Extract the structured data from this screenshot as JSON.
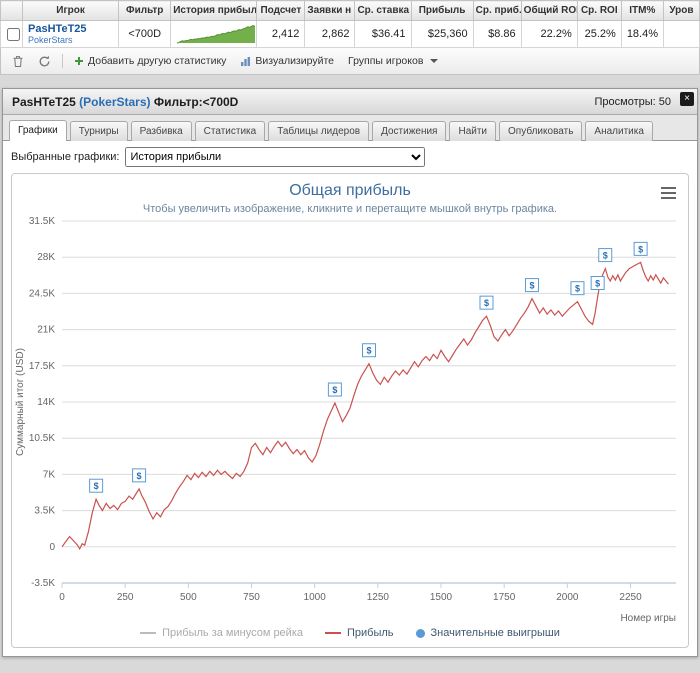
{
  "colors": {
    "accent_blue": "#2a6db5",
    "player_link": "#15569c",
    "sparkline_fill": "#74B04A",
    "sparkline_stroke": "#55913A",
    "chart_title": "#3E6E9E",
    "chart_subtitle": "#6D869F",
    "grid": "#DCDCDC",
    "axis_line": "#C0D0E0",
    "axis_text": "#666666",
    "profit_line": "#C9524F",
    "marker_blue": "#5B9BD5",
    "marker_text": "#2a6db5",
    "legend_text": "#3E576F",
    "legend_disabled": "#AAAAAA"
  },
  "table": {
    "columns": [
      "",
      "Игрок",
      "Фильтр",
      "История прибыли",
      "Подсчет",
      "Заявки н у",
      "Ср. ставка",
      "Прибыль",
      "Ср. приб.",
      "Общий ROI",
      "Ср. ROI",
      "ITM%",
      "Уров"
    ],
    "row": {
      "player": "PasHTeT25",
      "network": "PokerStars",
      "filter": "<700D",
      "count": "2,412",
      "entries": "2,862",
      "avg_stake": "$36.41",
      "profit": "$25,360",
      "avg_profit": "$8.86",
      "total_roi": "22.2%",
      "avg_roi": "25.2%",
      "itm": "18.4%",
      "level": "",
      "sparkline": [
        0,
        0.02,
        0.08,
        0.12,
        0.1,
        0.14,
        0.13,
        0.17,
        0.2,
        0.18,
        0.22,
        0.21,
        0.25,
        0.24,
        0.28,
        0.27,
        0.3,
        0.33,
        0.31,
        0.35,
        0.38,
        0.36,
        0.42,
        0.47,
        0.45,
        0.5,
        0.53,
        0.51,
        0.56,
        0.6,
        0.58,
        0.63,
        0.67,
        0.65,
        0.7,
        0.74,
        0.72,
        0.77,
        0.8,
        0.85,
        0.9,
        0.87,
        0.93,
        0.97,
        0.92
      ]
    }
  },
  "toolbar": {
    "add_stat": "Добавить другую статистику",
    "visualize": "Визуализируйте",
    "groups": "Группы игроков"
  },
  "panel": {
    "title": {
      "name": "PasHTeT25",
      "network": "(PokerStars)",
      "filter": "Фильтр:<700D"
    },
    "views": "Просмотры: 50",
    "close": "×",
    "tabs": [
      {
        "label": "Графики",
        "active": true
      },
      {
        "label": "Турниры",
        "active": false
      },
      {
        "label": "Разбивка",
        "active": false
      },
      {
        "label": "Статистика",
        "active": false
      },
      {
        "label": "Таблицы лидеров",
        "active": false
      },
      {
        "label": "Достижения",
        "active": false
      },
      {
        "label": "Найти",
        "active": false
      },
      {
        "label": "Опубликовать",
        "active": false
      },
      {
        "label": "Аналитика",
        "active": false
      }
    ],
    "selector": {
      "label": "Выбранные графики:",
      "value": "История прибыли"
    }
  },
  "chart_data": {
    "type": "line",
    "title": "Общая прибыль",
    "subtitle": "Чтобы увеличить изображение, кликните и перетащите мышкой внутрь графика.",
    "ylabel": "Суммарный итог (USD)",
    "xlabel": "Номер игры",
    "xlim": [
      0,
      2430
    ],
    "ylim": [
      -3500,
      31500
    ],
    "grid": true,
    "legend_position": "bottom",
    "xticks": [
      [
        0,
        "0"
      ],
      [
        250,
        "250"
      ],
      [
        500,
        "500"
      ],
      [
        750,
        "750"
      ],
      [
        1000,
        "1000"
      ],
      [
        1250,
        "1250"
      ],
      [
        1500,
        "1500"
      ],
      [
        1750,
        "1750"
      ],
      [
        2000,
        "2000"
      ],
      [
        2250,
        "2250"
      ]
    ],
    "yticks": [
      [
        -3500,
        "-3.5K"
      ],
      [
        0,
        "0"
      ],
      [
        3500,
        "3.5K"
      ],
      [
        7000,
        "7K"
      ],
      [
        10500,
        "10.5K"
      ],
      [
        14000,
        "14K"
      ],
      [
        17500,
        "17.5K"
      ],
      [
        21000,
        "21K"
      ],
      [
        24500,
        "24.5K"
      ],
      [
        28000,
        "28K"
      ],
      [
        31500,
        "31.5K"
      ]
    ],
    "legend": [
      {
        "label": "Прибыль за минусом рейка",
        "color": "#BBBBBB",
        "type": "line",
        "disabled": true
      },
      {
        "label": "Прибыль",
        "color": "#C9524F",
        "type": "line",
        "disabled": false
      },
      {
        "label": "Значительные выигрыши",
        "color": "#5B9BD5",
        "type": "dot",
        "disabled": false
      }
    ],
    "series": [
      {
        "name": "Прибыль",
        "color": "#C9524F",
        "points": [
          [
            0,
            0
          ],
          [
            15,
            500
          ],
          [
            30,
            1000
          ],
          [
            45,
            600
          ],
          [
            60,
            200
          ],
          [
            70,
            -200
          ],
          [
            80,
            300
          ],
          [
            90,
            150
          ],
          [
            105,
            1500
          ],
          [
            120,
            3300
          ],
          [
            135,
            4600
          ],
          [
            145,
            4100
          ],
          [
            160,
            3500
          ],
          [
            175,
            4200
          ],
          [
            190,
            3700
          ],
          [
            205,
            4000
          ],
          [
            220,
            3600
          ],
          [
            235,
            4200
          ],
          [
            250,
            4400
          ],
          [
            265,
            4900
          ],
          [
            280,
            4600
          ],
          [
            295,
            5200
          ],
          [
            305,
            5600
          ],
          [
            315,
            5000
          ],
          [
            330,
            4300
          ],
          [
            345,
            3400
          ],
          [
            360,
            2700
          ],
          [
            375,
            3300
          ],
          [
            390,
            2900
          ],
          [
            405,
            3600
          ],
          [
            420,
            3900
          ],
          [
            435,
            4500
          ],
          [
            450,
            5200
          ],
          [
            465,
            5800
          ],
          [
            480,
            6300
          ],
          [
            495,
            6900
          ],
          [
            510,
            6500
          ],
          [
            525,
            7100
          ],
          [
            540,
            6700
          ],
          [
            555,
            7200
          ],
          [
            570,
            6800
          ],
          [
            585,
            7300
          ],
          [
            600,
            6900
          ],
          [
            615,
            7400
          ],
          [
            630,
            7000
          ],
          [
            645,
            7300
          ],
          [
            660,
            6900
          ],
          [
            675,
            6600
          ],
          [
            690,
            7100
          ],
          [
            705,
            6800
          ],
          [
            720,
            7300
          ],
          [
            735,
            8100
          ],
          [
            750,
            9600
          ],
          [
            765,
            10000
          ],
          [
            780,
            9400
          ],
          [
            795,
            8900
          ],
          [
            810,
            9600
          ],
          [
            825,
            9100
          ],
          [
            840,
            9700
          ],
          [
            855,
            10200
          ],
          [
            870,
            9700
          ],
          [
            885,
            10100
          ],
          [
            900,
            9500
          ],
          [
            915,
            9000
          ],
          [
            930,
            9400
          ],
          [
            945,
            8900
          ],
          [
            960,
            9300
          ],
          [
            975,
            8600
          ],
          [
            990,
            8200
          ],
          [
            1005,
            8800
          ],
          [
            1020,
            9900
          ],
          [
            1035,
            11200
          ],
          [
            1050,
            12300
          ],
          [
            1065,
            13100
          ],
          [
            1080,
            13900
          ],
          [
            1095,
            13000
          ],
          [
            1110,
            12100
          ],
          [
            1125,
            12700
          ],
          [
            1140,
            13400
          ],
          [
            1155,
            14600
          ],
          [
            1170,
            15700
          ],
          [
            1185,
            16500
          ],
          [
            1200,
            17100
          ],
          [
            1215,
            17700
          ],
          [
            1230,
            16800
          ],
          [
            1245,
            16100
          ],
          [
            1260,
            15700
          ],
          [
            1275,
            16400
          ],
          [
            1290,
            15900
          ],
          [
            1305,
            16500
          ],
          [
            1320,
            17000
          ],
          [
            1335,
            16600
          ],
          [
            1350,
            17100
          ],
          [
            1365,
            16700
          ],
          [
            1380,
            17300
          ],
          [
            1395,
            17900
          ],
          [
            1410,
            17400
          ],
          [
            1425,
            18000
          ],
          [
            1440,
            18400
          ],
          [
            1455,
            18000
          ],
          [
            1470,
            18600
          ],
          [
            1485,
            18200
          ],
          [
            1500,
            19000
          ],
          [
            1515,
            18400
          ],
          [
            1530,
            17900
          ],
          [
            1545,
            18500
          ],
          [
            1560,
            19100
          ],
          [
            1575,
            19600
          ],
          [
            1590,
            20100
          ],
          [
            1605,
            19500
          ],
          [
            1620,
            20000
          ],
          [
            1635,
            20700
          ],
          [
            1650,
            21300
          ],
          [
            1665,
            21900
          ],
          [
            1680,
            22300
          ],
          [
            1695,
            21400
          ],
          [
            1710,
            20300
          ],
          [
            1725,
            19900
          ],
          [
            1740,
            20500
          ],
          [
            1755,
            21000
          ],
          [
            1770,
            20400
          ],
          [
            1785,
            20900
          ],
          [
            1800,
            21500
          ],
          [
            1815,
            22100
          ],
          [
            1830,
            22600
          ],
          [
            1845,
            23200
          ],
          [
            1860,
            24000
          ],
          [
            1875,
            23300
          ],
          [
            1890,
            22600
          ],
          [
            1905,
            23100
          ],
          [
            1920,
            22500
          ],
          [
            1935,
            22900
          ],
          [
            1950,
            22400
          ],
          [
            1965,
            22800
          ],
          [
            1980,
            22300
          ],
          [
            1995,
            22700
          ],
          [
            2010,
            23100
          ],
          [
            2025,
            23400
          ],
          [
            2040,
            23700
          ],
          [
            2055,
            23000
          ],
          [
            2070,
            22300
          ],
          [
            2085,
            21800
          ],
          [
            2100,
            21500
          ],
          [
            2110,
            22600
          ],
          [
            2120,
            24200
          ],
          [
            2130,
            25600
          ],
          [
            2140,
            26300
          ],
          [
            2150,
            26900
          ],
          [
            2160,
            26100
          ],
          [
            2170,
            25700
          ],
          [
            2180,
            26200
          ],
          [
            2190,
            25800
          ],
          [
            2200,
            26300
          ],
          [
            2210,
            25700
          ],
          [
            2220,
            26100
          ],
          [
            2230,
            26500
          ],
          [
            2245,
            26900
          ],
          [
            2260,
            27100
          ],
          [
            2275,
            27300
          ],
          [
            2290,
            27500
          ],
          [
            2300,
            26700
          ],
          [
            2310,
            26100
          ],
          [
            2320,
            25700
          ],
          [
            2330,
            26200
          ],
          [
            2340,
            25800
          ],
          [
            2350,
            26300
          ],
          [
            2360,
            25900
          ],
          [
            2370,
            25500
          ],
          [
            2380,
            26000
          ],
          [
            2390,
            25700
          ],
          [
            2400,
            25400
          ]
        ]
      }
    ],
    "markers": {
      "name": "Значительные выигрыши",
      "symbol": "$",
      "color": "#5B9BD5",
      "points": [
        [
          135,
          4600
        ],
        [
          305,
          5600
        ],
        [
          1080,
          13900
        ],
        [
          1215,
          17700
        ],
        [
          1680,
          22300
        ],
        [
          1860,
          24000
        ],
        [
          2040,
          23700
        ],
        [
          2120,
          24200
        ],
        [
          2150,
          26900
        ],
        [
          2290,
          27500
        ]
      ]
    }
  }
}
